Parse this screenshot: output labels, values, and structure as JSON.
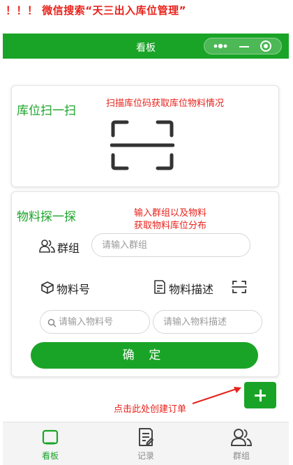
{
  "promo_text": "！！！ 微信搜索“天三出入库位管理”",
  "titlebar": {
    "title": "看板"
  },
  "scan_card": {
    "title": "库位扫一扫",
    "note": "扫描库位码获取库位物料情况"
  },
  "probe_card": {
    "title": "物料探一探",
    "note_line1": "输入群组以及物料",
    "note_line2": "获取物料库位分布",
    "group_label": "群组",
    "group_placeholder": "请输入群组",
    "material_no_label": "物料号",
    "material_desc_label": "物料描述",
    "material_no_placeholder": "请输入物料号",
    "material_desc_placeholder": "请输入物料描述",
    "confirm_label": "确 定"
  },
  "fab_note": "点击此处创建订单",
  "tabbar": {
    "items": [
      {
        "label": "看板",
        "icon": "board-icon",
        "active": true
      },
      {
        "label": "记录",
        "icon": "record-icon",
        "active": false
      },
      {
        "label": "群组",
        "icon": "group-icon",
        "active": false
      }
    ]
  },
  "colors": {
    "brand_green": "#1aa427",
    "annotation_red": "#e8221b"
  }
}
